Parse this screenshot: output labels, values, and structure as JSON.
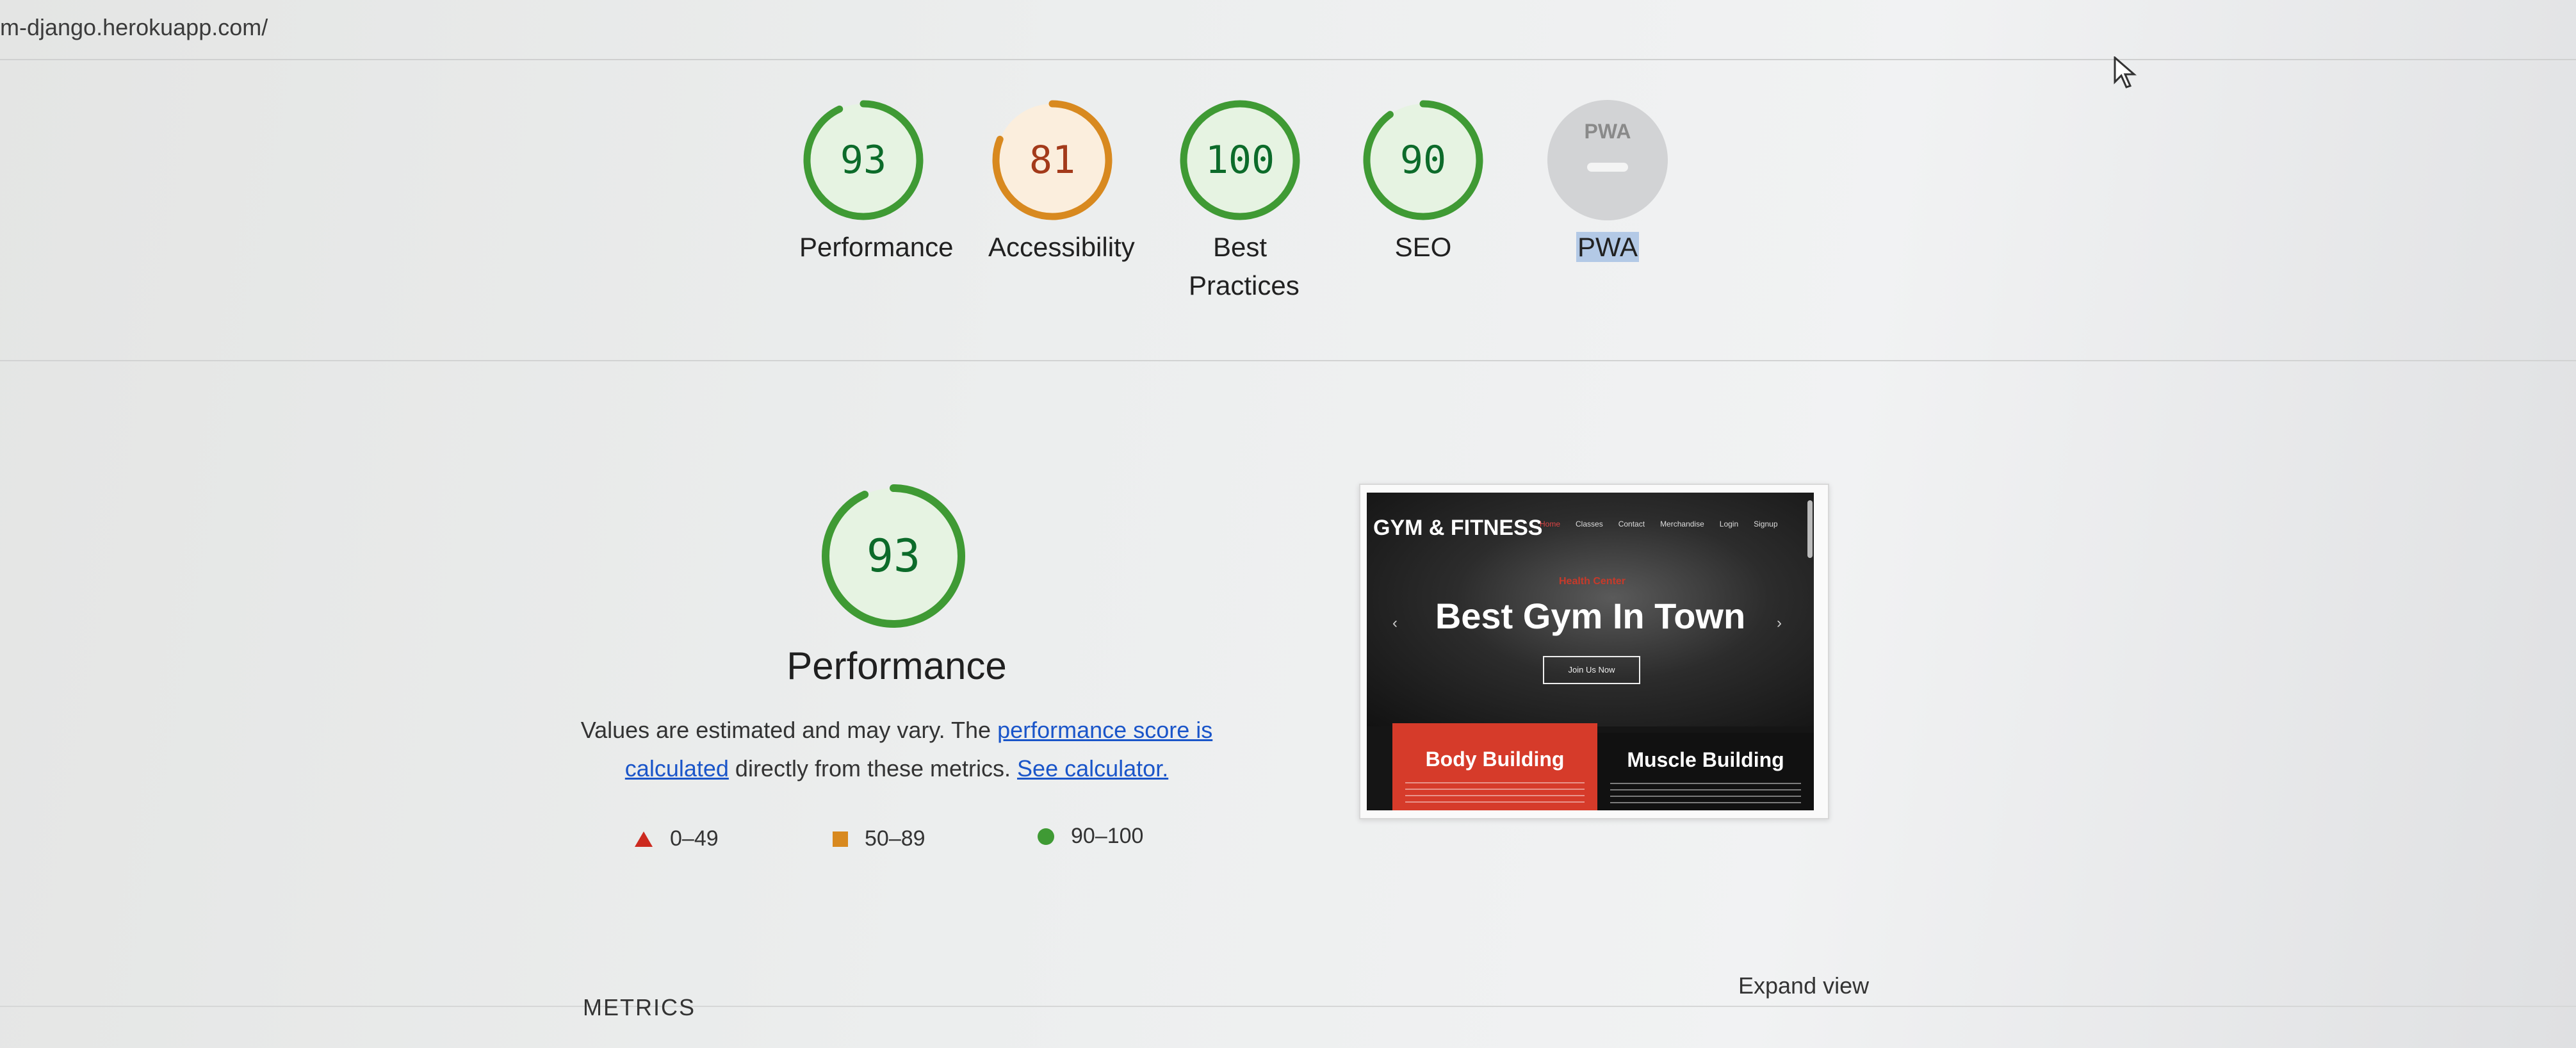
{
  "browser": {
    "url": "m-django.herokuapp.com/"
  },
  "colors": {
    "good": "#0c7a2f",
    "good_ring": "#3f9a34",
    "average": "#b2451b",
    "average_ring": "#d8891f",
    "fail": "#c33",
    "pwa_bg": "#d2d3d5",
    "link": "#1a55c9"
  },
  "gauges": [
    {
      "label": "Performance",
      "score": 93,
      "rating": "good"
    },
    {
      "label": "Accessibility",
      "score": 81,
      "rating": "average"
    },
    {
      "label": "Best Practices",
      "score": 100,
      "rating": "good"
    },
    {
      "label": "SEO",
      "score": 90,
      "rating": "good"
    },
    {
      "label": "PWA",
      "badge": "PWA",
      "rating": "na"
    }
  ],
  "performance": {
    "score": "93",
    "title": "Performance",
    "desc_before": "Values are estimated and may vary. The",
    "link_score": "performance score is calculated",
    "desc_middle": "directly from these metrics.",
    "link_calculator": "See calculator.",
    "legend": [
      {
        "icon": "triangle-icon",
        "range": "0–49"
      },
      {
        "icon": "square-icon",
        "range": "50–89"
      },
      {
        "icon": "circle-icon",
        "range": "90–100"
      }
    ]
  },
  "screenshot": {
    "logo": "GYM & FITNESS",
    "nav": [
      "Home",
      "Classes",
      "Contact",
      "Merchandise",
      "Login",
      "Signup"
    ],
    "hero_subtitle": "Health Center",
    "hero_title": "Best Gym In Town",
    "hero_button": "Join Us Now",
    "cards": [
      "Body Building",
      "Muscle Building"
    ]
  },
  "metrics_heading": "METRICS",
  "expand_view": "Expand view"
}
